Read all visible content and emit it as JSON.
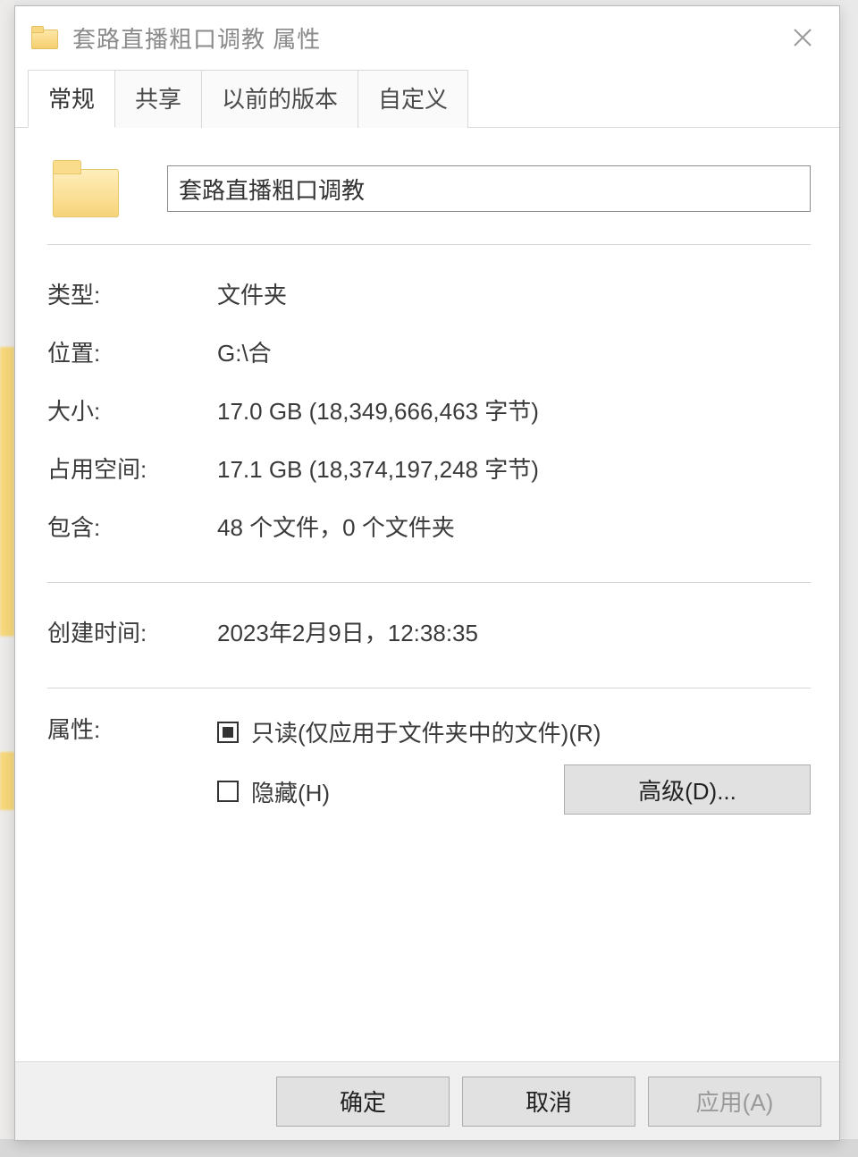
{
  "titlebar": {
    "title": "套路直播粗口调教 属性"
  },
  "tabs": {
    "general": "常规",
    "sharing": "共享",
    "previous_versions": "以前的版本",
    "customize": "自定义"
  },
  "general": {
    "folder_name": "套路直播粗口调教",
    "labels": {
      "type": "类型:",
      "location": "位置:",
      "size": "大小:",
      "size_on_disk": "占用空间:",
      "contains": "包含:",
      "created": "创建时间:",
      "attributes": "属性:"
    },
    "values": {
      "type": "文件夹",
      "location": "G:\\合",
      "size": "17.0 GB (18,349,666,463 字节)",
      "size_on_disk": "17.1 GB (18,374,197,248 字节)",
      "contains": "48 个文件，0 个文件夹",
      "created": "2023年2月9日，12:38:35"
    },
    "checkboxes": {
      "readonly_label": "只读(仅应用于文件夹中的文件)(R)",
      "hidden_label": "隐藏(H)"
    },
    "buttons": {
      "advanced": "高级(D)..."
    }
  },
  "footer": {
    "ok": "确定",
    "cancel": "取消",
    "apply": "应用(A)"
  }
}
